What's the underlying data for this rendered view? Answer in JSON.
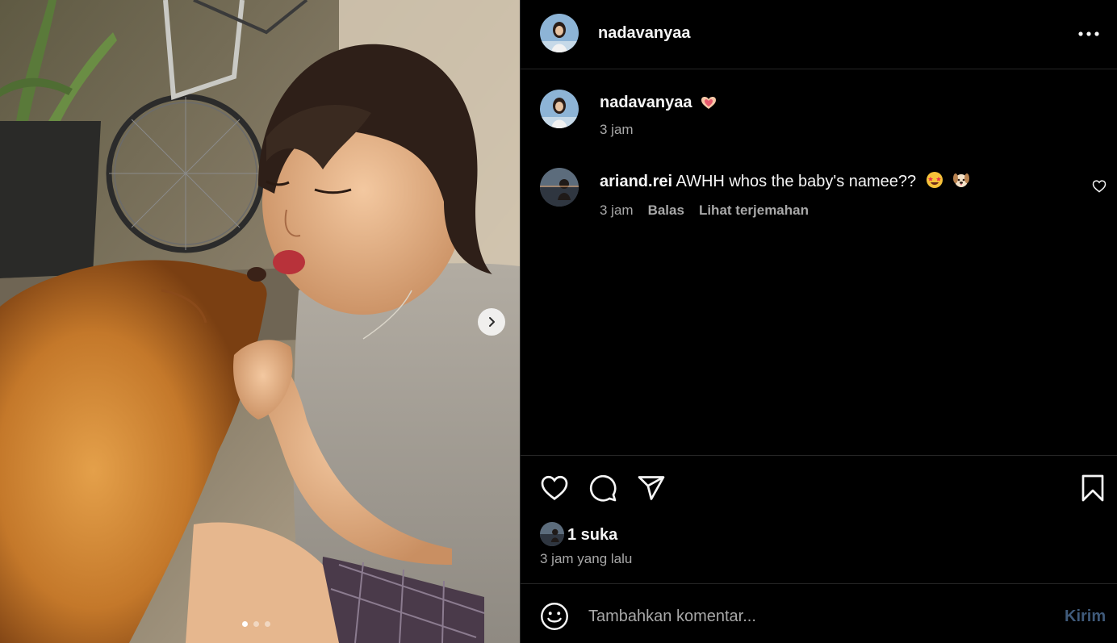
{
  "post": {
    "username": "nadavanyaa",
    "more_icon": "more-horizontal-icon",
    "media": {
      "description_icon": "photo-carousel",
      "slide_count": 3,
      "active_slide": 1
    }
  },
  "caption": {
    "username": "nadavanyaa",
    "emoji": "heart-hands-emoji",
    "time": "3 jam"
  },
  "comments": [
    {
      "username": "ariand.rei",
      "text": "AWHH whos the baby's namee??",
      "emojis": [
        "star-struck-emoji",
        "puppy-face-emoji"
      ],
      "time": "3 jam",
      "reply_label": "Balas",
      "translate_label": "Lihat terjemahan"
    }
  ],
  "actions": {
    "like_icon": "heart-icon",
    "comment_icon": "comment-icon",
    "share_icon": "send-icon",
    "save_icon": "bookmark-icon"
  },
  "likes": {
    "count_label": "1 suka",
    "time_ago": "3 jam yang lalu"
  },
  "comment_input": {
    "placeholder": "Tambahkan komentar...",
    "value": "",
    "send_label": "Kirim"
  },
  "colors": {
    "background": "#000000",
    "text_primary": "#f5f5f5",
    "text_secondary": "#a8a8a8",
    "divider": "#262626",
    "send_disabled": "#3f5a7a"
  }
}
